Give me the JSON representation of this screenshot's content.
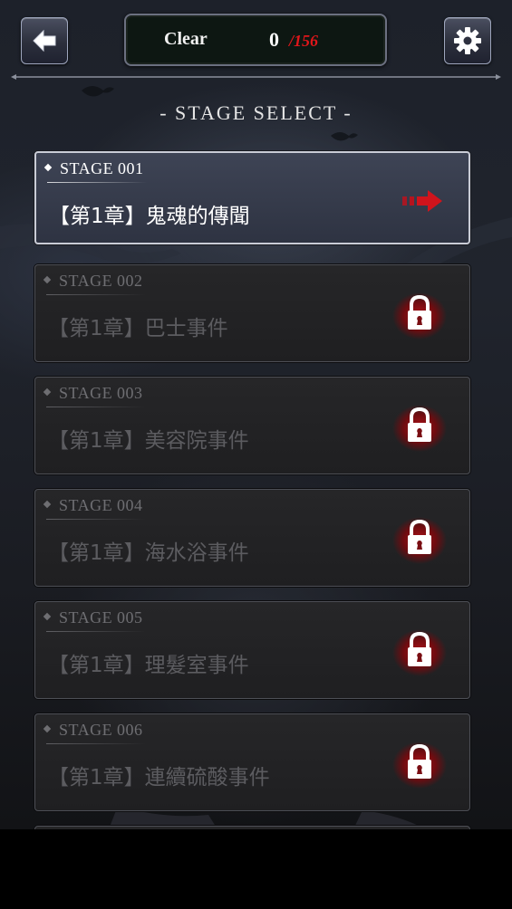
{
  "header": {
    "clear_label": "Clear",
    "clear_count": "0",
    "clear_total": "/156"
  },
  "page_title": "- STAGE SELECT -",
  "stages": [
    {
      "number": "STAGE 001",
      "title": "【第1章】鬼魂的傳聞",
      "status": "unlocked"
    },
    {
      "number": "STAGE 002",
      "title": "【第1章】巴士事件",
      "status": "locked"
    },
    {
      "number": "STAGE 003",
      "title": "【第1章】美容院事件",
      "status": "locked"
    },
    {
      "number": "STAGE 004",
      "title": "【第1章】海水浴事件",
      "status": "locked"
    },
    {
      "number": "STAGE 005",
      "title": "【第1章】理髮室事件",
      "status": "locked"
    },
    {
      "number": "STAGE 006",
      "title": "【第1章】連續硫酸事件",
      "status": "locked"
    }
  ],
  "colors": {
    "accent_red": "#e0161a",
    "arrow_red": "#c4101a",
    "lock_glow": "#8a0f14"
  },
  "icons": {
    "back": "arrow-left-icon",
    "settings": "gear-icon",
    "go": "double-arrow-right-icon",
    "locked": "padlock-icon"
  }
}
